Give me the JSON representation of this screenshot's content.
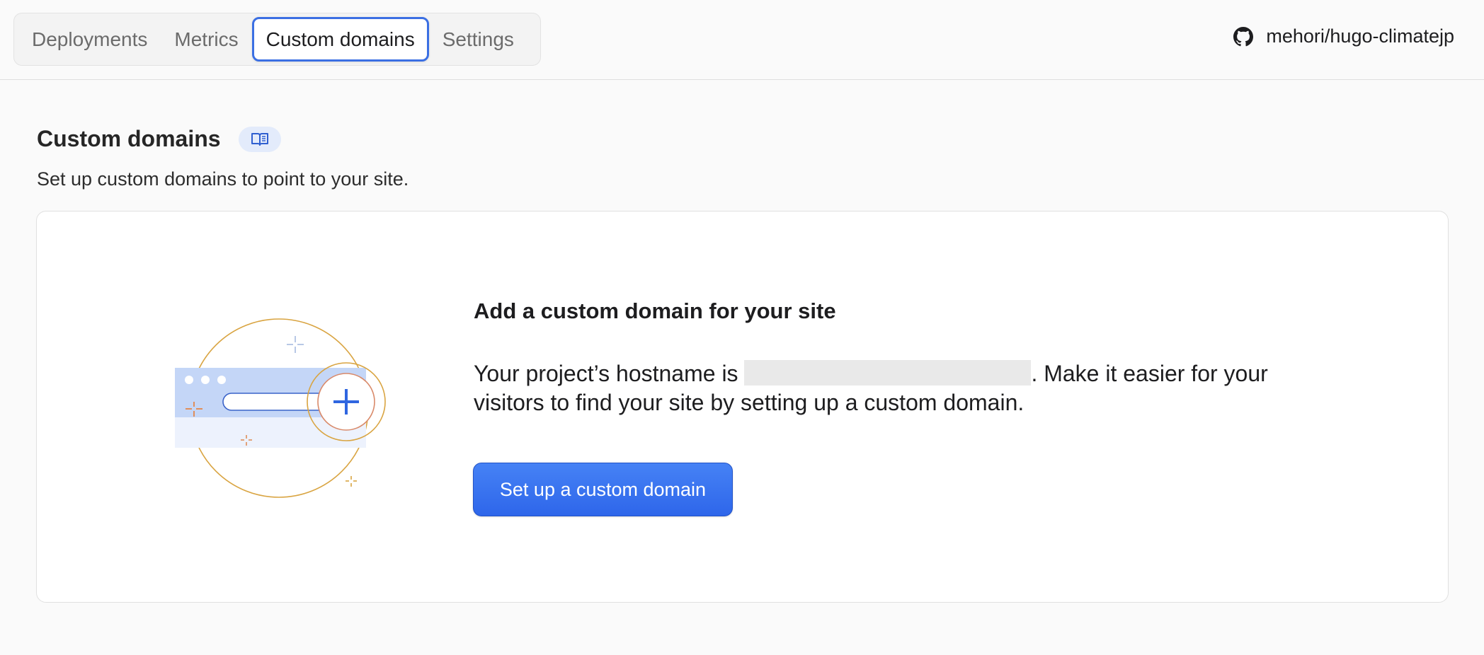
{
  "tabs": [
    {
      "label": "Deployments",
      "active": false
    },
    {
      "label": "Metrics",
      "active": false
    },
    {
      "label": "Custom domains",
      "active": true
    },
    {
      "label": "Settings",
      "active": false
    }
  ],
  "repo": {
    "icon": "github-icon",
    "name": "mehori/hugo-climatejp"
  },
  "section": {
    "title": "Custom domains",
    "doc_icon": "book-icon",
    "subtitle": "Set up custom domains to point to your site."
  },
  "card": {
    "heading": "Add a custom domain for your site",
    "text_before": "Your project’s hostname is",
    "text_after": ". Make it easier for your visitors to find your site by setting up a custom domain.",
    "button_label": "Set up a custom domain"
  },
  "colors": {
    "accent": "#3b6fe3",
    "button": "#2e66ea",
    "illustration_gold": "#d9a441",
    "illustration_blue": "#c4d6f7"
  }
}
